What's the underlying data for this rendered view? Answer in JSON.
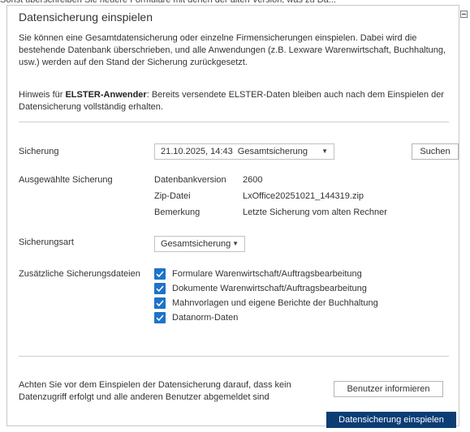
{
  "top_cut_text": "Sonst überschreiben Sie neuere Formulare mit denen der alten Version, was zu Da...",
  "title": "Datensicherung einspielen",
  "intro_text": "Sie können eine Gesamtdatensicherung oder einzelne Firmensicherungen einspielen. Dabei wird die bestehende Datenbank überschrieben, und alle Anwendungen (z.B. Lexware Warenwirtschaft, Buchhaltung, usw.) werden auf den Stand der Sicherung zurückgesetzt.",
  "hint": {
    "prefix": "Hinweis für ",
    "bold": "ELSTER-Anwender",
    "suffix": ": Bereits versendete ELSTER-Daten bleiben auch nach dem Einspielen der Datensicherung vollständig erhalten."
  },
  "sicherung": {
    "label": "Sicherung",
    "selected": "21.10.2025, 14:43  Gesamtsicherung",
    "search_button": "Suchen"
  },
  "selected_backup": {
    "label": "Ausgewählte Sicherung",
    "rows": [
      {
        "key": "Datenbankversion",
        "value": "2600"
      },
      {
        "key": "Zip-Datei",
        "value": "LxOffice20251021_144319.zip"
      },
      {
        "key": "Bemerkung",
        "value": "Letzte Sicherung vom alten Rechner"
      }
    ]
  },
  "backup_type": {
    "label": "Sicherungsart",
    "selected": "Gesamtsicherung"
  },
  "extra_files": {
    "label": "Zusätzliche Sicherungsdateien",
    "items": [
      {
        "label": "Formulare Warenwirtschaft/Auftragsbearbeitung",
        "checked": true
      },
      {
        "label": "Dokumente Warenwirtschaft/Auftragsbearbeitung",
        "checked": true
      },
      {
        "label": "Mahnvorlagen und eigene Berichte der Buchhaltung",
        "checked": true
      },
      {
        "label": "Datanorm-Daten",
        "checked": true
      }
    ]
  },
  "footer": {
    "warning": "Achten Sie vor dem Einspielen der Datensicherung darauf, dass kein Datenzugriff erfolgt und alle anderen Benutzer abgemeldet sind",
    "inform_button": "Benutzer informieren",
    "restore_button": "Datensicherung einspielen"
  },
  "colors": {
    "checkbox": "#1e73c8",
    "primary_button": "#0b3d74"
  }
}
